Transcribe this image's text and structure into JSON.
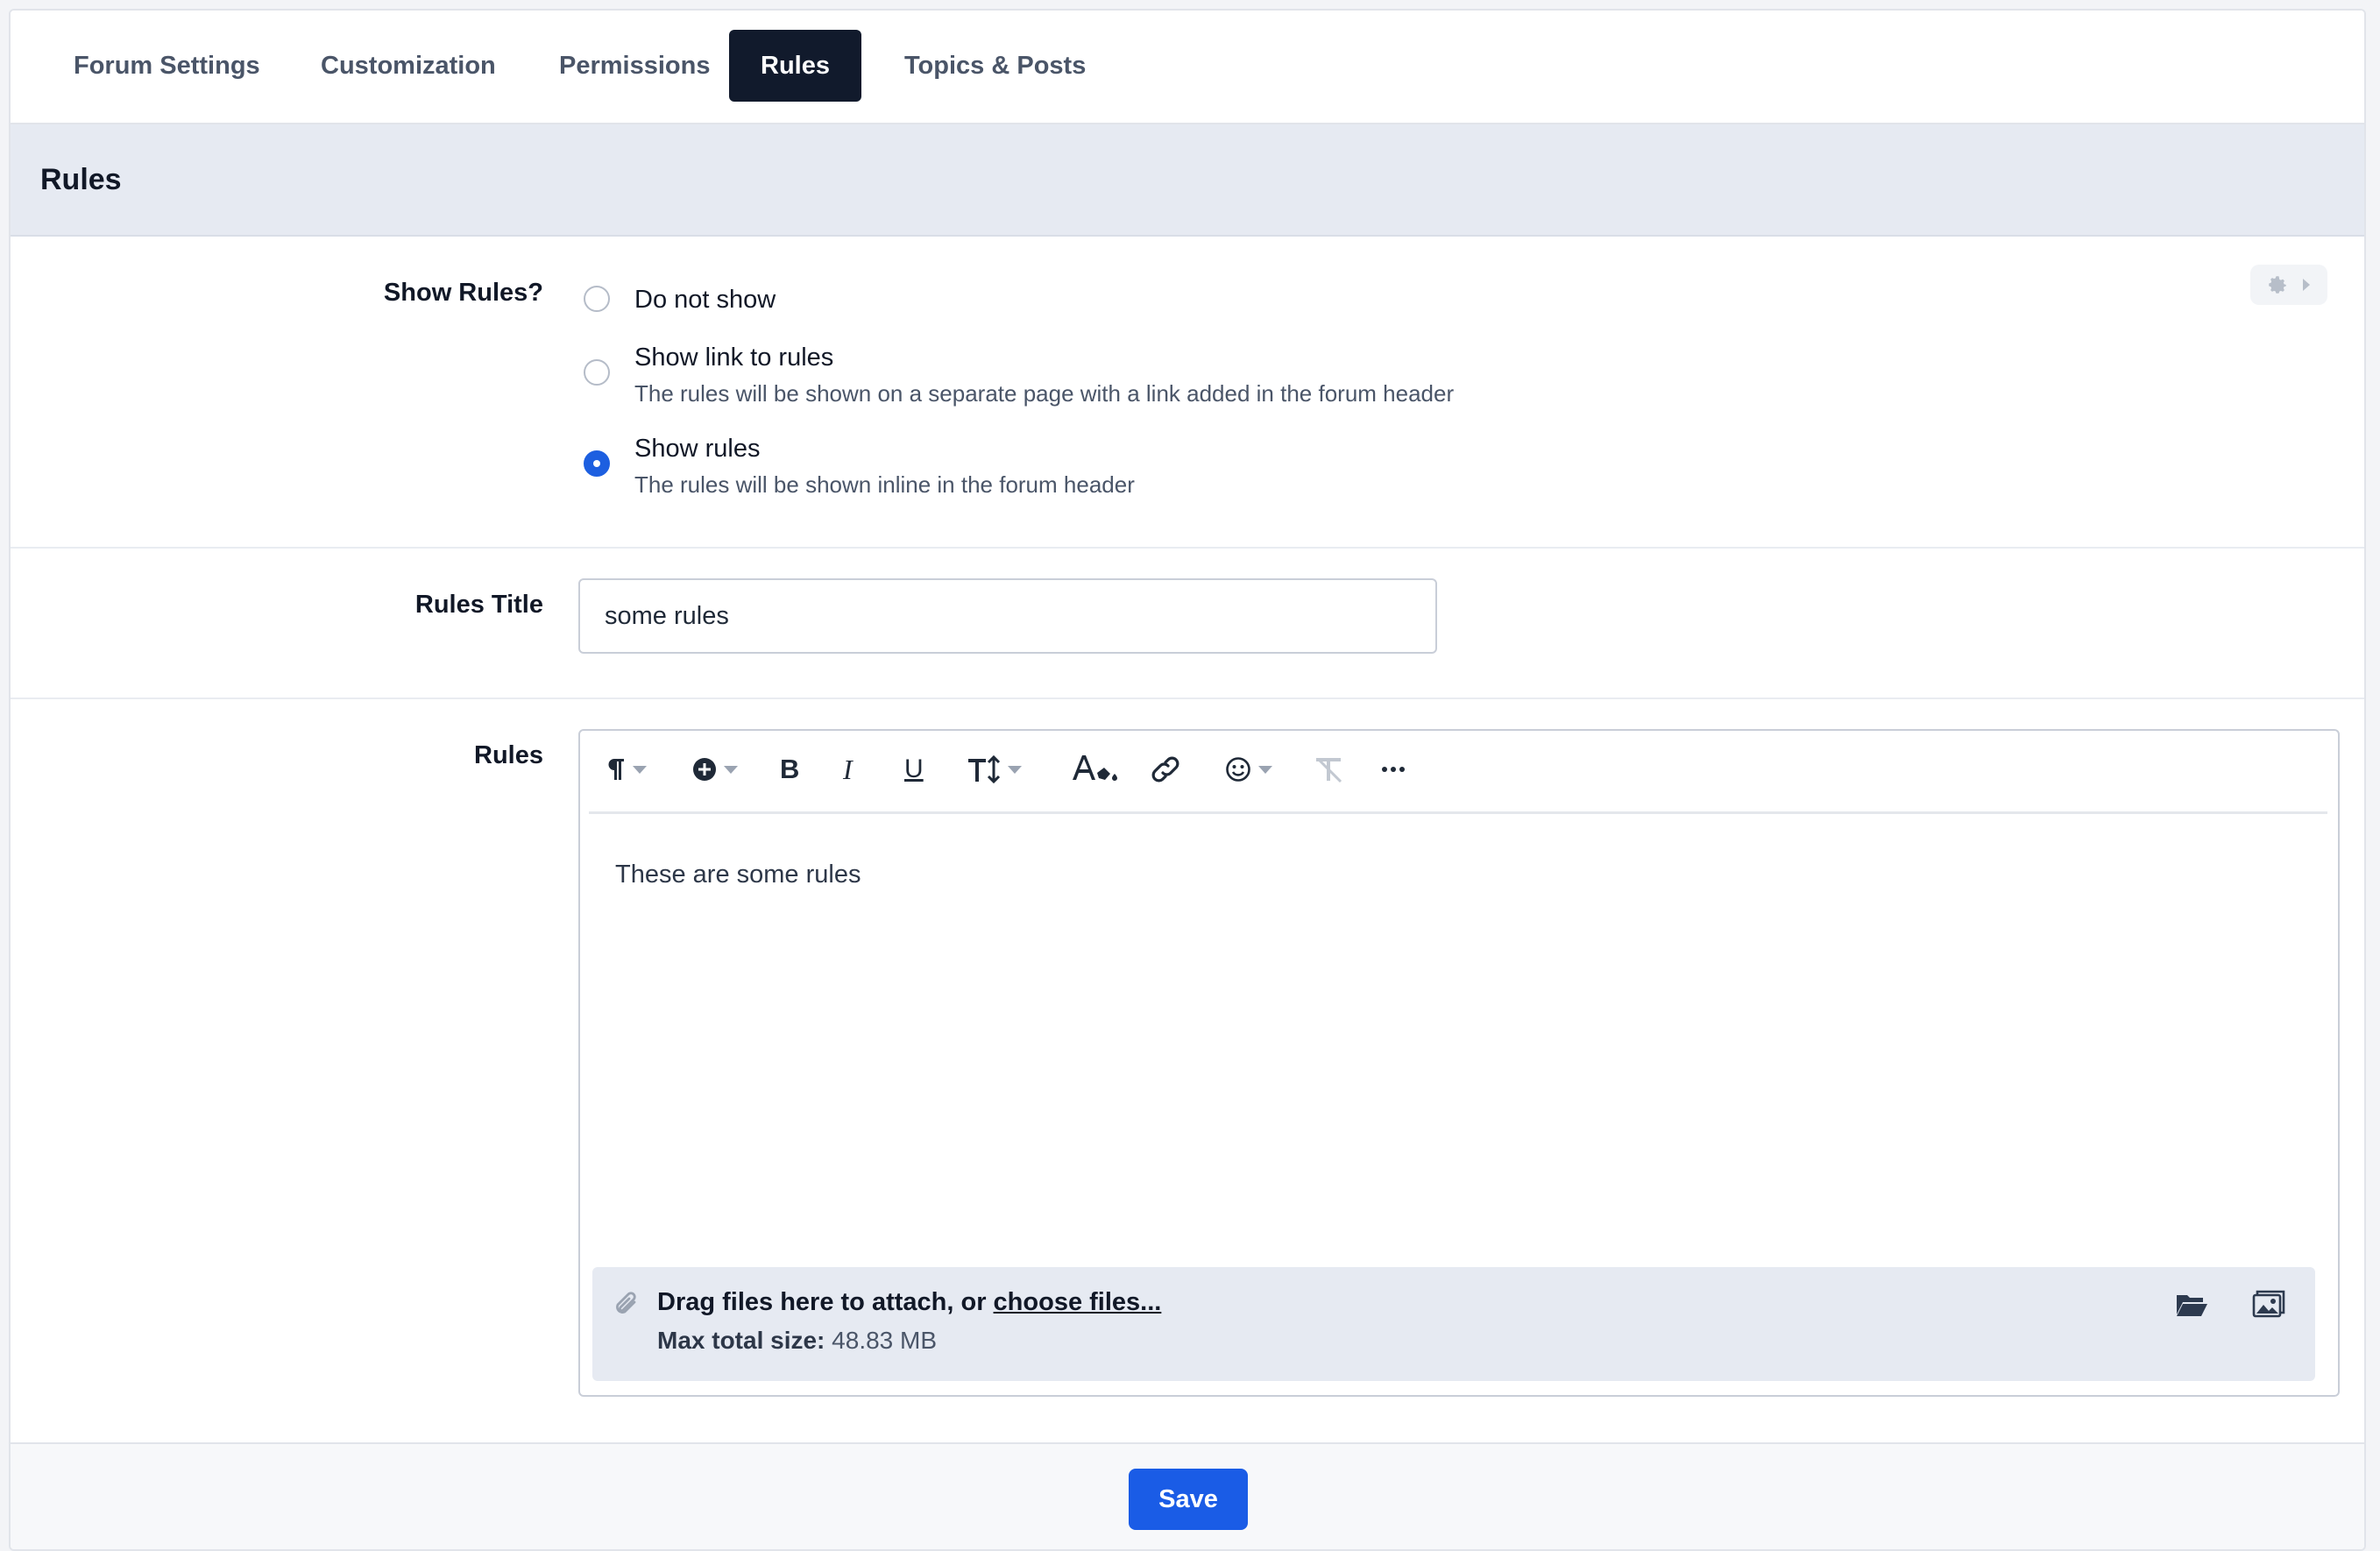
{
  "tabs": [
    {
      "label": "Forum Settings",
      "active": false
    },
    {
      "label": "Customization",
      "active": false
    },
    {
      "label": "Permissions",
      "active": false
    },
    {
      "label": "Rules",
      "active": true
    },
    {
      "label": "Topics & Posts",
      "active": false
    }
  ],
  "section": {
    "title": "Rules"
  },
  "show_rules": {
    "label": "Show Rules?",
    "options": [
      {
        "label": "Do not show",
        "description": "",
        "checked": false
      },
      {
        "label": "Show link to rules",
        "description": "The rules will be shown on a separate page with a link added in the forum header",
        "checked": false
      },
      {
        "label": "Show rules",
        "description": "The rules will be shown inline in the forum header",
        "checked": true
      }
    ]
  },
  "rules_title": {
    "label": "Rules Title",
    "value": "some rules"
  },
  "rules_editor": {
    "label": "Rules",
    "toolbar": [
      "paragraph-format-icon",
      "insert-icon",
      "bold-icon",
      "italic-icon",
      "underline-icon",
      "font-size-icon",
      "text-color-icon",
      "link-icon",
      "emoji-icon",
      "clear-formatting-icon",
      "more-icon"
    ],
    "content": "These are some rules",
    "attach": {
      "prompt": "Drag files here to attach, or ",
      "link": "choose files...",
      "max_label": "Max total size:",
      "max_value": " 48.83 MB"
    }
  },
  "footer": {
    "save_label": "Save"
  },
  "colors": {
    "accent": "#1a5ce6",
    "active_tab": "#111a2c",
    "section_bg": "#e6eaf2"
  }
}
